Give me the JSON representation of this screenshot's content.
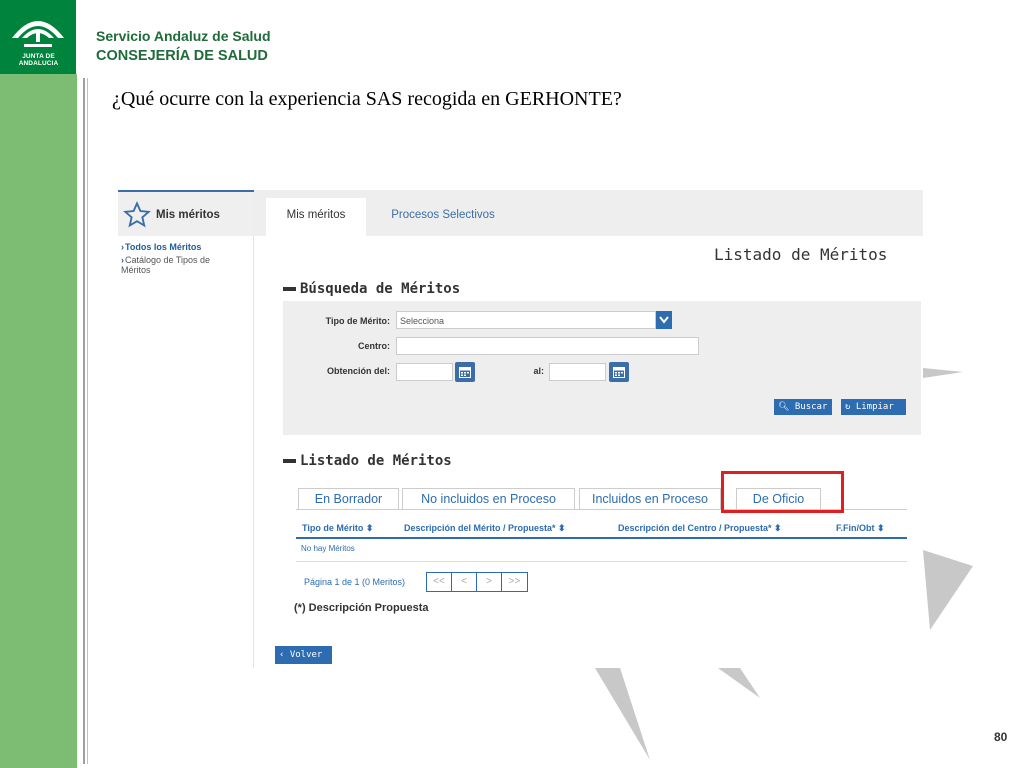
{
  "slide": {
    "logo_text": "JUNTA DE ANDALUCIA",
    "org_line1": "Servicio Andaluz de Salud",
    "org_line2": "CONSEJERÍA DE SALUD",
    "title": "¿Qué ocurre con la experiencia SAS recogida en GERHONTE?",
    "page_number": "80"
  },
  "app": {
    "sidebar": {
      "title": "Mis méritos",
      "items": [
        {
          "label": "Todos los Méritos",
          "active": true
        },
        {
          "label": "Catálogo de Tipos de Méritos",
          "active": false
        }
      ]
    },
    "topnav": {
      "tabs": [
        {
          "label": "Mis méritos",
          "active": true
        },
        {
          "label": "Procesos Selectivos",
          "active": false
        }
      ]
    },
    "page_heading": "Listado de Méritos",
    "search": {
      "section_title": "Búsqueda de Méritos",
      "tipo_label": "Tipo de Mérito:",
      "tipo_value": "Selecciona",
      "centro_label": "Centro:",
      "centro_value": "",
      "obtencion_label": "Obtención del:",
      "obtencion_value": "",
      "al_label": "al:",
      "al_value": "",
      "buscar_label": "Buscar",
      "limpiar_label": "Limpiar"
    },
    "listado": {
      "section_title": "Listado de Méritos",
      "tabs": [
        {
          "label": "En Borrador"
        },
        {
          "label": "No incluidos en Proceso"
        },
        {
          "label": "Incluidos en Proceso"
        },
        {
          "label": "De Oficio",
          "highlighted": true
        }
      ],
      "columns": [
        "Tipo de Mérito ⬍",
        "Descripción del Mérito / Propuesta* ⬍",
        "Descripción del Centro / Propuesta* ⬍",
        "F.Fin/Obt ⬍"
      ],
      "empty_message": "No hay Méritos",
      "page_info": "Página 1 de 1 (0 Meritos)",
      "pager": [
        "<<",
        "<",
        ">",
        ">>"
      ],
      "note": "(*) Descripción Propuesta",
      "back_label": "Volver"
    }
  },
  "colors": {
    "green_band": "#7dbc73",
    "logo_green": "#00843d",
    "accent_blue": "#2d6cb0",
    "highlight_red": "#e02020"
  }
}
